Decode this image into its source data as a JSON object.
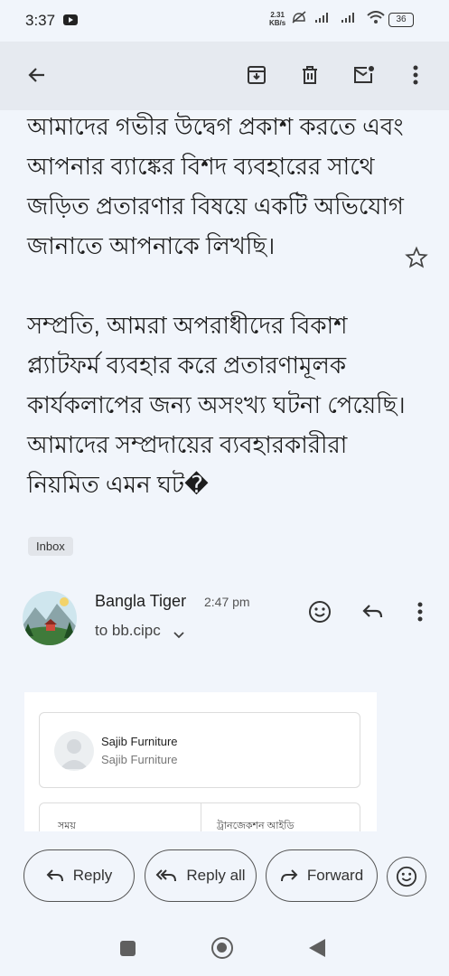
{
  "status_bar": {
    "time": "3:37",
    "net_speed_value": "2.31",
    "net_speed_unit": "KB/s",
    "battery": "36",
    "icons": [
      "youtube-icon",
      "mute-icon",
      "signal-icon",
      "signal-icon",
      "wifi-icon",
      "battery-icon"
    ]
  },
  "toolbar": {
    "icons": [
      "back-arrow-icon",
      "archive-icon",
      "delete-icon",
      "mark-unread-icon",
      "more-vert-icon"
    ]
  },
  "email": {
    "paragraph1": "আমাদের গভীর উদ্বেগ প্রকাশ করতে এবং আপনার ব্যাঙ্কের বিশদ ব্যবহারের সাথে জড়িত প্রতারণার বিষয়ে একটি অভিযোগ জানাতে আপনাকে লিখছি।",
    "paragraph2": "সম্প্রতি, আমরা অপরাধীদের বিকাশ প্ল্যাটফর্ম ব্যবহার করে প্রতারণামূলক কার্যকলাপের জন্য অসংখ্য ঘটনা পেয়েছি। আমাদের সম্প্রদায়ের ব্যবহারকারীরা নিয়মিত এমন ঘট�",
    "label": "Inbox"
  },
  "sender": {
    "name": "Bangla Tiger",
    "time": "2:47 pm",
    "to": "to bb.cipc"
  },
  "embedded_card": {
    "title": "Sajib Furniture",
    "subtitle": "Sajib Furniture",
    "col1": "সময়",
    "col2": "ট্রানজেকশন আইডি"
  },
  "actions": {
    "reply": "Reply",
    "reply_all": "Reply all",
    "forward": "Forward"
  },
  "colors": {
    "background": "#f1f5fb",
    "toolbar": "#e6eaf0",
    "text": "#1d1d1d"
  }
}
